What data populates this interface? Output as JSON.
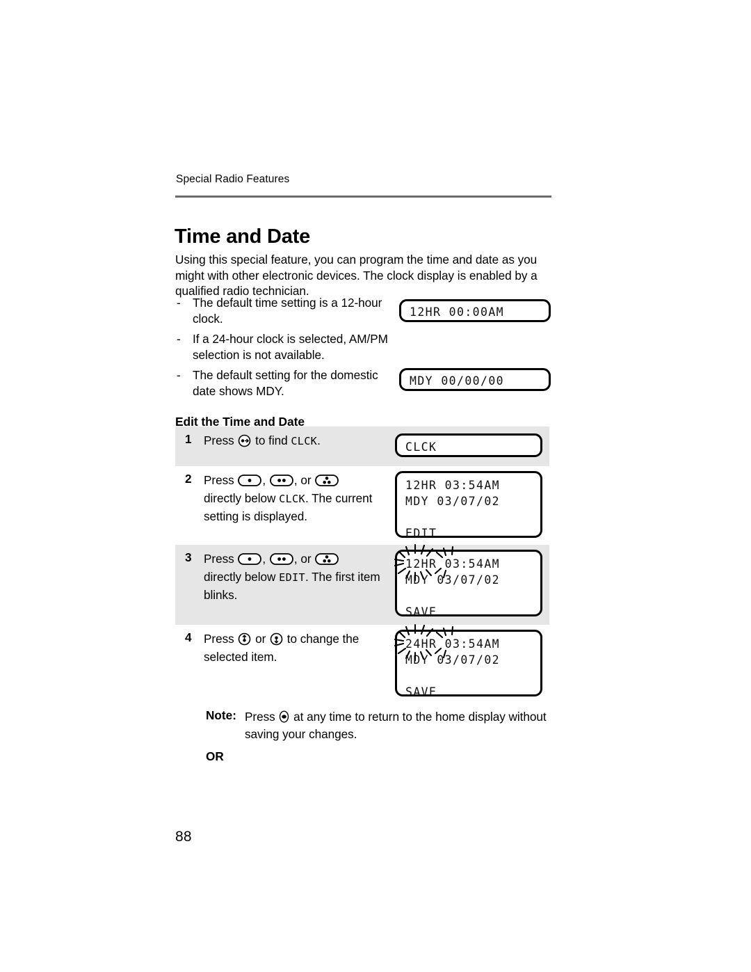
{
  "page": {
    "running_head": "Special Radio Features",
    "folio": "88"
  },
  "heading": {
    "title": "Time and Date",
    "subtitle": "Edit the Time and Date"
  },
  "intro": "Using this special feature, you can program the time and date as you might with other electronic devices. The clock display is enabled by a qualified radio technician.",
  "bullets": [
    {
      "dash": "-",
      "text": "The default time setting is a 12-hour clock."
    },
    {
      "dash": "-",
      "text": "If a 24-hour clock is selected, AM/PM selection is not available."
    },
    {
      "dash": "-",
      "text": "The default setting for the domestic date shows MDY."
    }
  ],
  "displays": {
    "default_time": {
      "lines": [
        "12HR 00:00AM"
      ]
    },
    "default_date": {
      "lines": [
        "MDY 00/00/00"
      ]
    },
    "step1": {
      "lines": [
        "CLCK"
      ]
    },
    "step2": {
      "lines": [
        "12HR 03:54AM",
        "MDY 03/07/02",
        "",
        "EDIT"
      ]
    },
    "step3": {
      "lines": [
        "12HR 03:54AM",
        "MDY 03/07/02",
        "",
        "SAVE"
      ],
      "blinking_item": "12HR"
    },
    "step4": {
      "lines": [
        "24HR 03:54AM",
        "MDY 03/07/02",
        "",
        "SAVE"
      ],
      "blinking_item": "24HR"
    }
  },
  "steps": [
    {
      "num": "1",
      "shaded": true,
      "parts": [
        {
          "t": "text",
          "v": "Press "
        },
        {
          "t": "icon",
          "v": "menu-select-button-icon"
        },
        {
          "t": "text",
          "v": " to find "
        },
        {
          "t": "mono",
          "v": "CLCK"
        },
        {
          "t": "text",
          "v": "."
        }
      ]
    },
    {
      "num": "2",
      "shaded": false,
      "parts": [
        {
          "t": "text",
          "v": "Press "
        },
        {
          "t": "icon",
          "v": "one-dot-softkey-icon"
        },
        {
          "t": "text",
          "v": ", "
        },
        {
          "t": "icon",
          "v": "two-dot-softkey-icon"
        },
        {
          "t": "text",
          "v": ", or "
        },
        {
          "t": "icon",
          "v": "three-dot-softkey-icon"
        },
        {
          "t": "break"
        },
        {
          "t": "text",
          "v": "directly below "
        },
        {
          "t": "mono",
          "v": "CLCK"
        },
        {
          "t": "text",
          "v": ". The current setting is displayed."
        }
      ]
    },
    {
      "num": "3",
      "shaded": true,
      "parts": [
        {
          "t": "text",
          "v": "Press "
        },
        {
          "t": "icon",
          "v": "one-dot-softkey-icon"
        },
        {
          "t": "text",
          "v": ", "
        },
        {
          "t": "icon",
          "v": "two-dot-softkey-icon"
        },
        {
          "t": "text",
          "v": ", or "
        },
        {
          "t": "icon",
          "v": "three-dot-softkey-icon"
        },
        {
          "t": "break"
        },
        {
          "t": "text",
          "v": "directly below "
        },
        {
          "t": "mono",
          "v": "EDIT"
        },
        {
          "t": "text",
          "v": ". The first item blinks."
        }
      ]
    },
    {
      "num": "4",
      "shaded": false,
      "parts": [
        {
          "t": "text",
          "v": "Press "
        },
        {
          "t": "icon",
          "v": "up-arrow-button-icon"
        },
        {
          "t": "text",
          "v": " or "
        },
        {
          "t": "icon",
          "v": "down-arrow-button-icon"
        },
        {
          "t": "text",
          "v": " to change the selected item."
        }
      ]
    }
  ],
  "note": {
    "label": "Note:",
    "parts": [
      {
        "t": "text",
        "v": "Press "
      },
      {
        "t": "icon",
        "v": "home-exit-button-icon"
      },
      {
        "t": "text",
        "v": " at any time to return to the home display without saving your changes."
      }
    ]
  },
  "or_label": "OR"
}
